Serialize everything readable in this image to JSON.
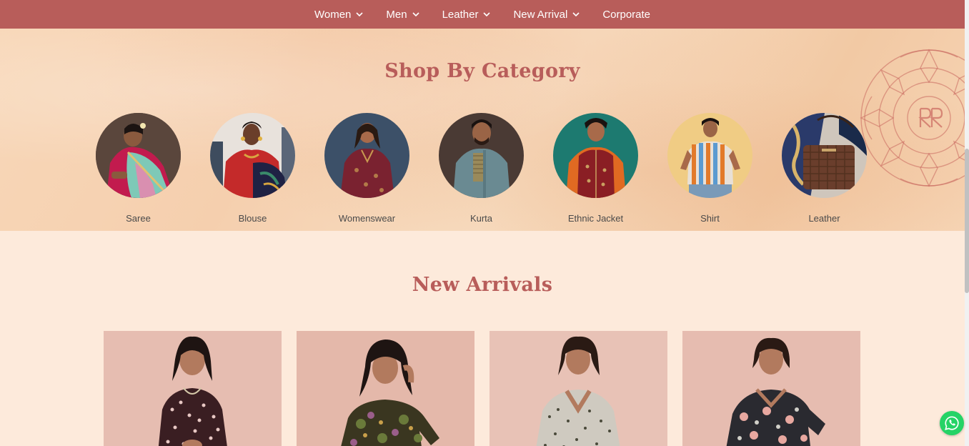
{
  "nav": {
    "items": [
      {
        "label": "Women",
        "has_dropdown": true
      },
      {
        "label": "Men",
        "has_dropdown": true
      },
      {
        "label": "Leather",
        "has_dropdown": true
      },
      {
        "label": "New Arrival",
        "has_dropdown": true
      },
      {
        "label": "Corporate",
        "has_dropdown": false
      }
    ]
  },
  "categories": {
    "title": "Shop By Category",
    "items": [
      {
        "label": "Saree"
      },
      {
        "label": "Blouse"
      },
      {
        "label": "Womenswear"
      },
      {
        "label": "Kurta"
      },
      {
        "label": "Ethnic Jacket"
      },
      {
        "label": "Shirt"
      },
      {
        "label": "Leather"
      }
    ]
  },
  "arrivals": {
    "title": "New Arrivals",
    "product_count": 4
  },
  "colors": {
    "brand": "#b85d5a",
    "page_bg": "#fdeadb",
    "whatsapp": "#25d366"
  },
  "icons": {
    "dropdown": "chevron-down-icon",
    "chat": "whatsapp-icon"
  }
}
